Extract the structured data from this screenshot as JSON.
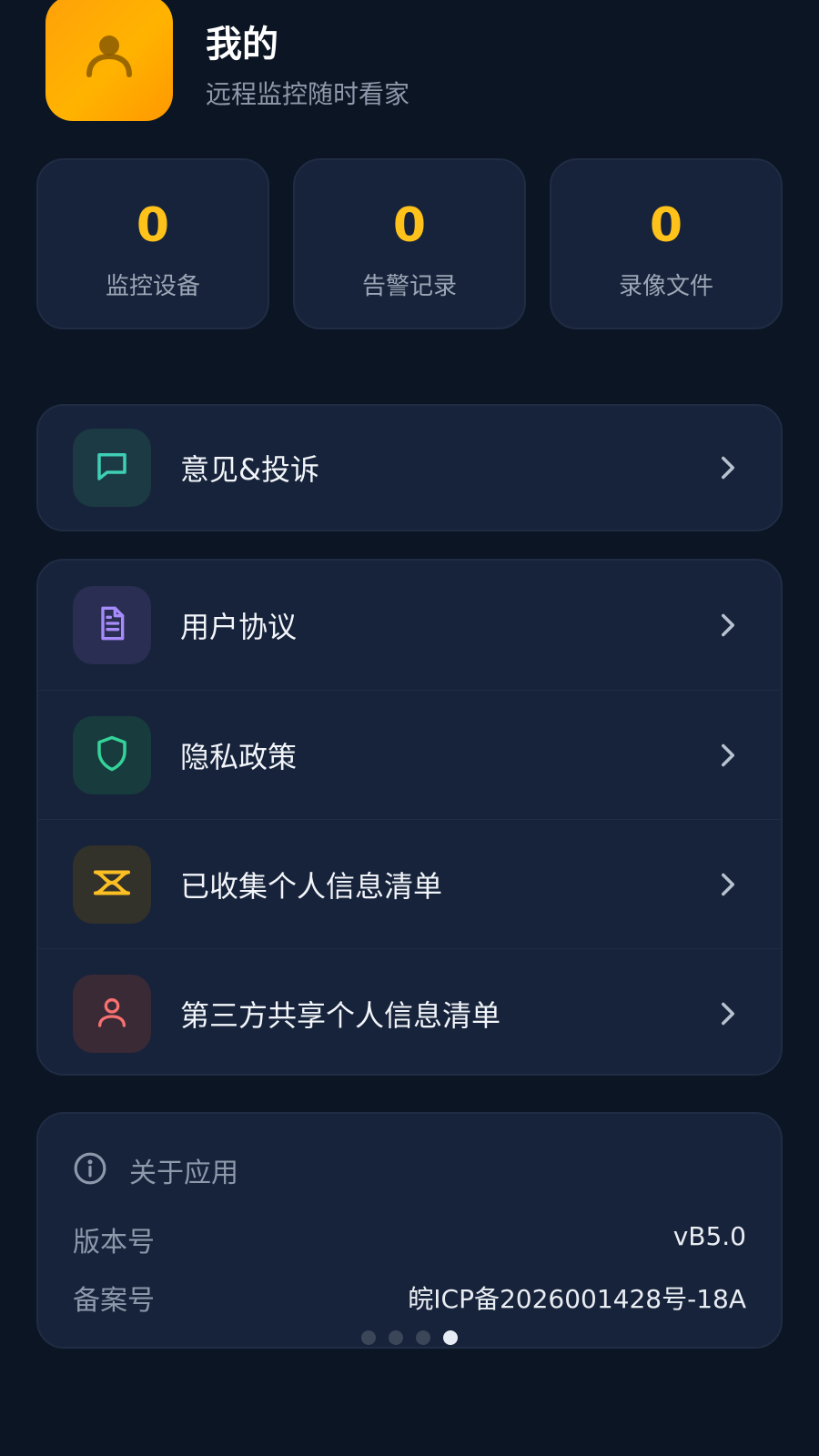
{
  "header": {
    "title": "我的",
    "subtitle": "远程监控随时看家",
    "avatar_icon": "user-icon"
  },
  "stats": [
    {
      "value": "0",
      "label": "监控设备"
    },
    {
      "value": "0",
      "label": "告警记录"
    },
    {
      "value": "0",
      "label": "录像文件"
    }
  ],
  "menu_feedback": {
    "label": "意见&投诉",
    "icon": "message-square-icon",
    "icon_color": "#3ecfb4"
  },
  "menu_legal": [
    {
      "label": "用户协议",
      "icon": "document-icon",
      "icon_color": "#a78bfa"
    },
    {
      "label": "隐私政策",
      "icon": "shield-icon",
      "icon_color": "#34d399"
    },
    {
      "label": "已收集个人信息清单",
      "icon": "list-icon",
      "icon_color": "#fbbf24"
    },
    {
      "label": "第三方共享个人信息清单",
      "icon": "user-icon",
      "icon_color": "#f87171"
    }
  ],
  "about": {
    "title": "关于应用",
    "version_label": "版本号",
    "version_value": "vB5.0",
    "icp_label": "备案号",
    "icp_value": "皖ICP备2026001428号-18A"
  },
  "pagination": {
    "count": 4,
    "active_index": 3
  },
  "colors": {
    "background": "#0c1523",
    "card": "#17233a",
    "accent": "#ffc21a",
    "avatar": "#ffa10a"
  }
}
